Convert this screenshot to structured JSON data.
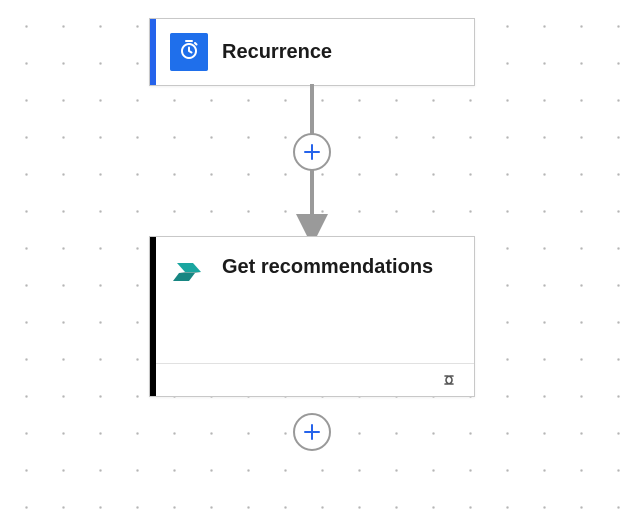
{
  "canvas": {
    "dot_color": "#b5b5b5"
  },
  "nodes": {
    "recurrence": {
      "title": "Recurrence",
      "accent_color": "#2563eb",
      "icon_tile_bg": "#1f6feb",
      "icon_name": "clock-icon"
    },
    "get_recommendations": {
      "title": "Get recommendations",
      "accent_color": "#000000",
      "icon_name": "power-automate-icon",
      "has_connection_footer": true
    }
  },
  "controls": {
    "add_step_label": "Add step"
  },
  "icon_colors": {
    "add_plus": "#2563eb",
    "connector": "#9a9a9a",
    "pa_primary": "#1aa6a0",
    "pa_dark": "#0b7f7b",
    "link_icon": "#555555"
  }
}
